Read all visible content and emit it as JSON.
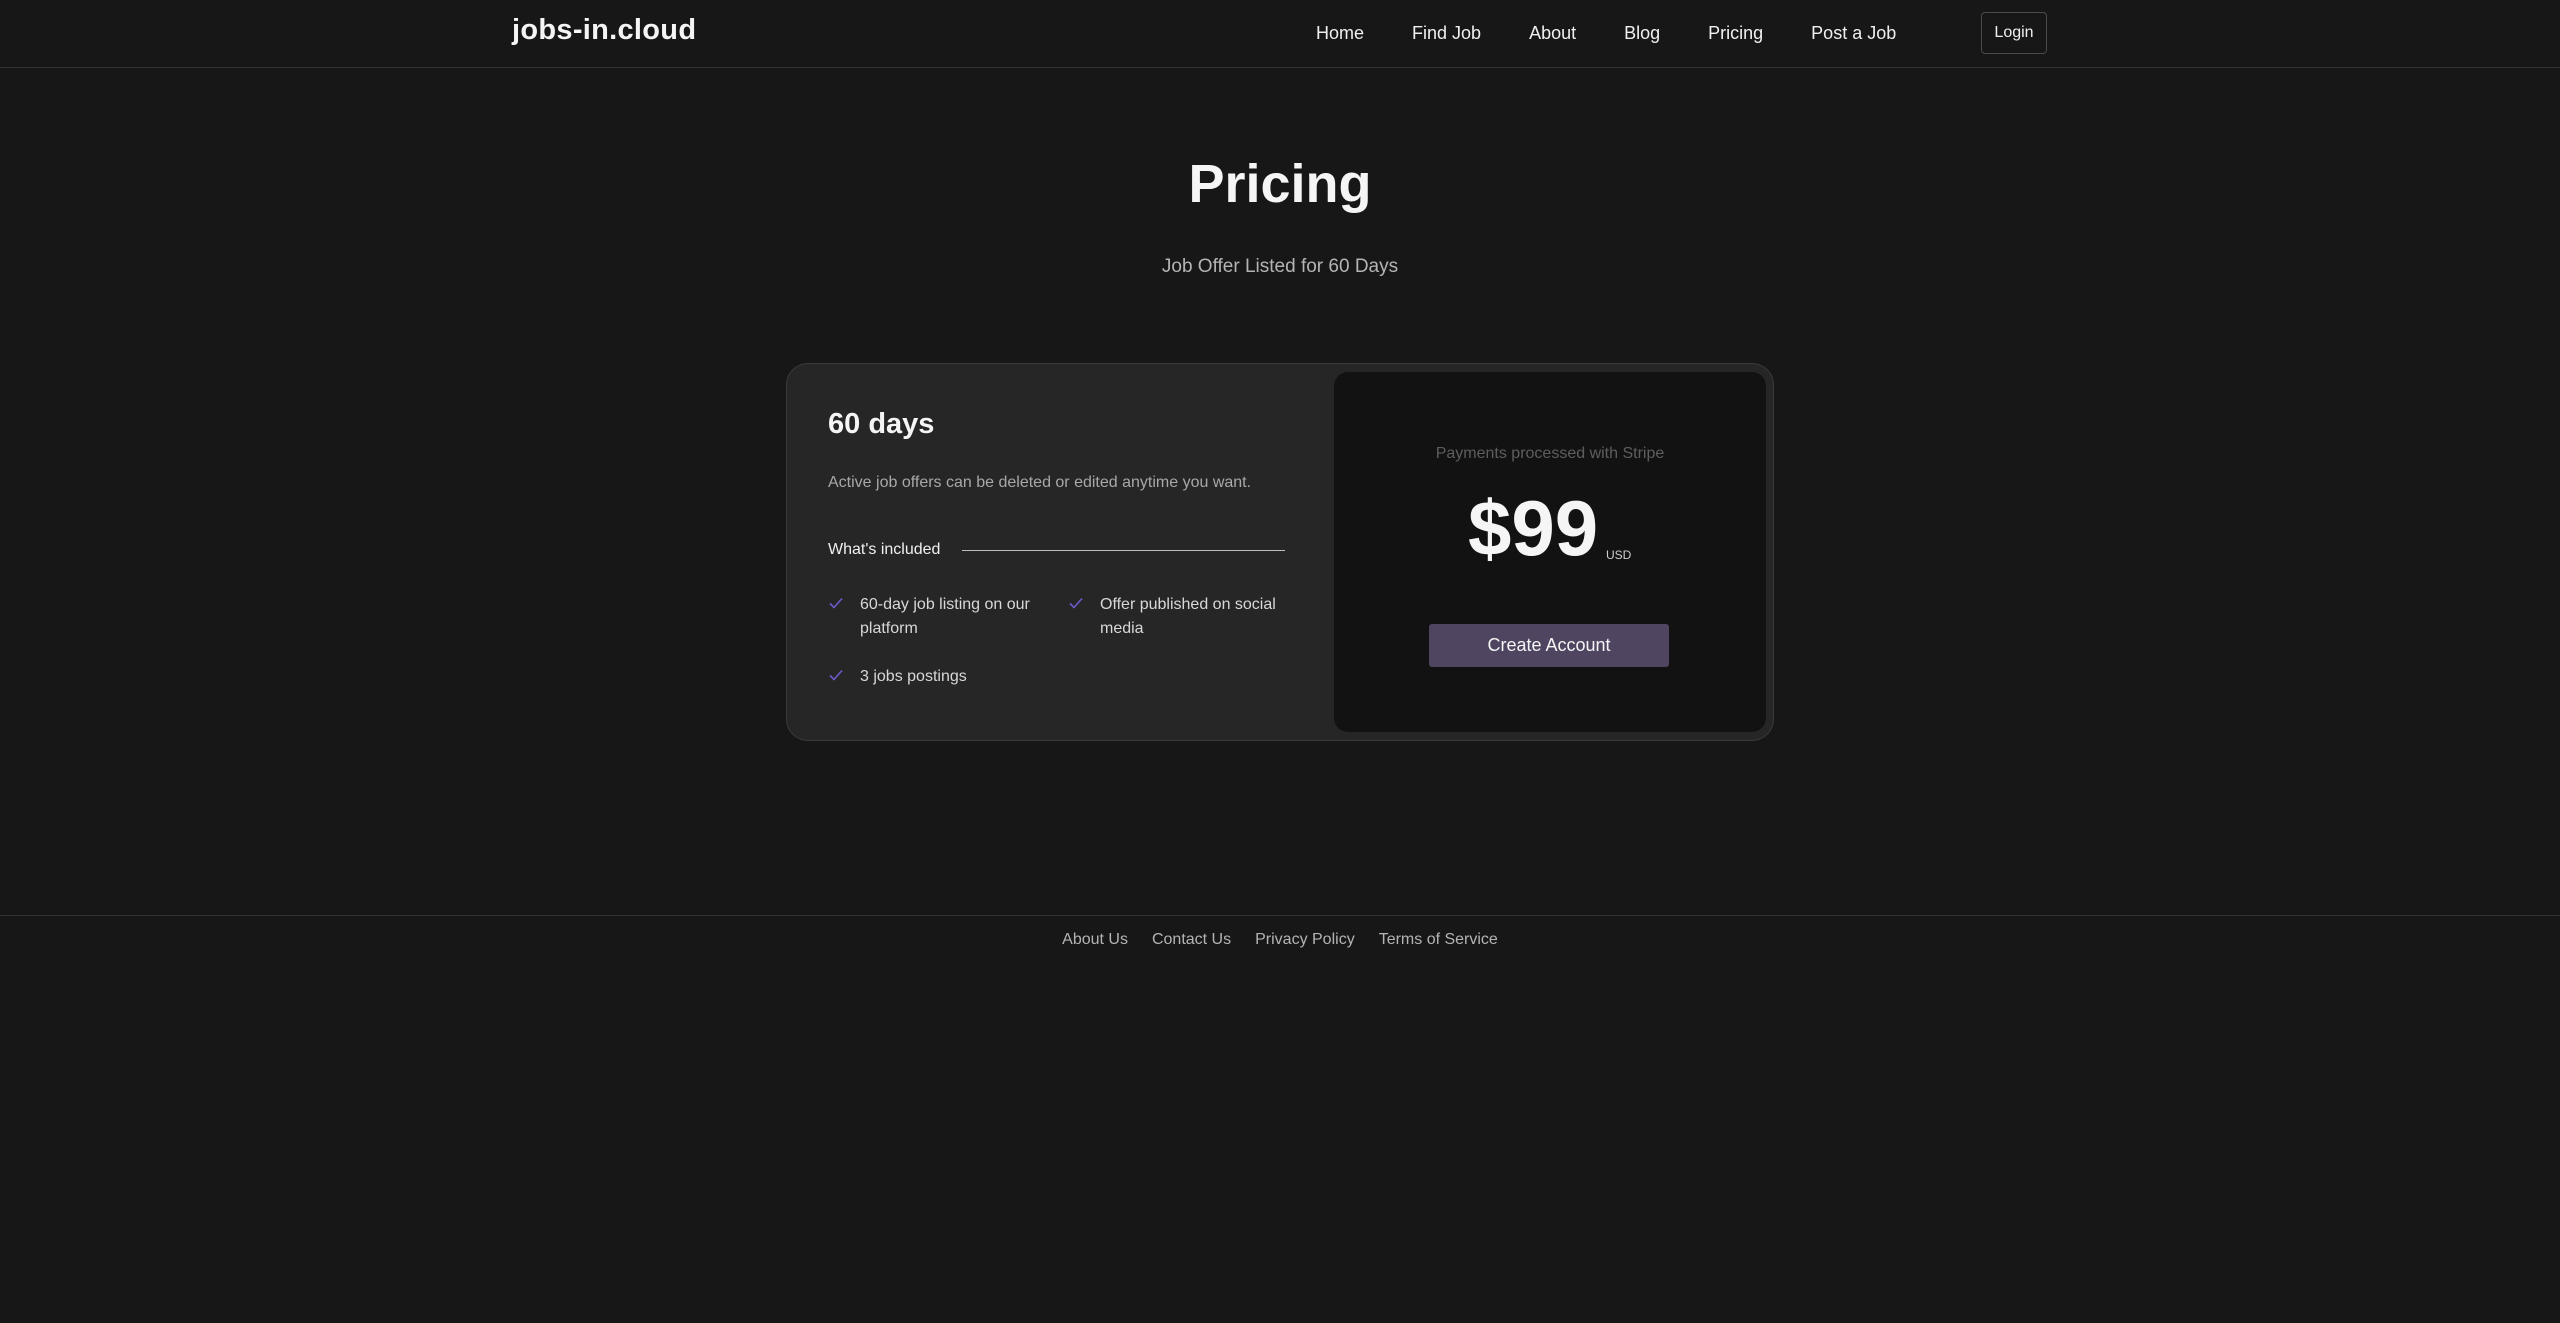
{
  "header": {
    "logo": "jobs-in.cloud",
    "nav": [
      "Home",
      "Find Job",
      "About",
      "Blog",
      "Pricing",
      "Post a Job"
    ],
    "login_label": "Login"
  },
  "hero": {
    "title": "Pricing",
    "subtitle": "Job Offer Listed for 60 Days"
  },
  "plan": {
    "name": "60 days",
    "description": "Active job offers can be deleted or edited anytime you want.",
    "included_label": "What's included",
    "features": [
      "60-day job listing on our platform",
      "Offer published on social media",
      "3 jobs postings"
    ],
    "check_icon": "check-icon",
    "check_color": "#6d5bd0"
  },
  "payment": {
    "note": "Payments processed with Stripe",
    "price": "$99",
    "currency": "USD",
    "cta_label": "Create Account",
    "cta_color": "#4f4560"
  },
  "footer": {
    "links": [
      "About Us",
      "Contact Us",
      "Privacy Policy",
      "Terms of Service"
    ]
  }
}
